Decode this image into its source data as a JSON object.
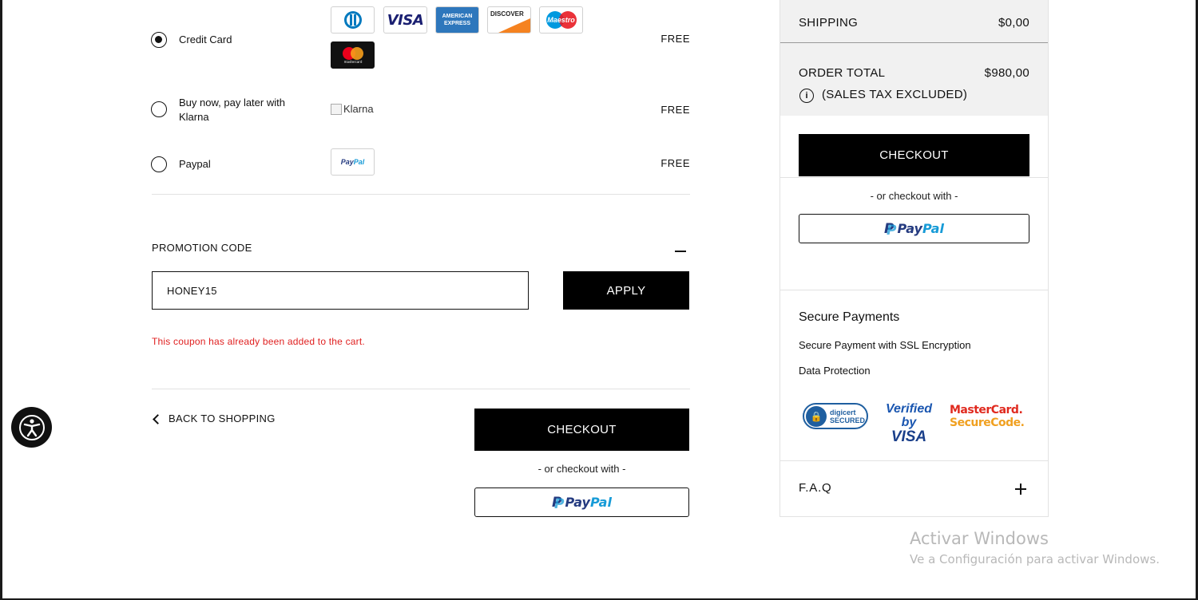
{
  "payment_methods": [
    {
      "id": "credit-card",
      "label": "Credit Card",
      "fee": "FREE",
      "selected": true,
      "logos": [
        "diners-club",
        "visa",
        "american-express",
        "discover",
        "maestro",
        "mastercard"
      ]
    },
    {
      "id": "klarna",
      "label": "Buy now, pay later with Klarna",
      "fee": "FREE",
      "selected": false,
      "logo_alt": "Klarna"
    },
    {
      "id": "paypal",
      "label": "Paypal",
      "fee": "FREE",
      "selected": false,
      "logos": [
        "paypal"
      ]
    }
  ],
  "logo_text": {
    "visa": "VISA",
    "amex_line1": "AMERICAN",
    "amex_line2": "EXPRESS",
    "discover": "DISCOVER",
    "maestro": "Maestro",
    "mastercard": "mastercard",
    "paypal_pay": "Pay",
    "paypal_pal": "Pal"
  },
  "promotion": {
    "title": "PROMOTION CODE",
    "toggle_icon": "minus-icon",
    "input_value": "HONEY15",
    "apply_label": "APPLY",
    "error": "This coupon has already been added to the cart.",
    "error_color": "#e02020"
  },
  "footer_actions": {
    "back_label": "BACK TO SHOPPING",
    "checkout_label": "CHECKOUT",
    "or_text": "- or checkout with -"
  },
  "summary": {
    "shipping_label": "SHIPPING",
    "shipping_value": "$0,00",
    "total_label": "ORDER TOTAL",
    "total_value": "$980,00",
    "tax_note": "(SALES TAX EXCLUDED)",
    "checkout_label": "CHECKOUT",
    "or_text": "- or checkout with -",
    "secure_title": "Secure Payments",
    "secure_line1": "Secure Payment with SSL Encryption",
    "secure_line2": "Data Protection",
    "badges": {
      "digicert_1": "digicert",
      "digicert_2": "SECURED",
      "vbv_1": "Verified by",
      "vbv_2": "VISA",
      "msc_1": "MasterCard.",
      "msc_2": "SecureCode."
    },
    "faq_label": "F.A.Q",
    "faq_icon": "plus-icon"
  },
  "watermark": {
    "line1": "Activar Windows",
    "line2": "Ve a Configuración para activar Windows."
  },
  "colors": {
    "primary": "#000000",
    "panel_bg": "#f1f1f1",
    "paypal_blue": "#253b80",
    "paypal_light": "#179bd7"
  }
}
